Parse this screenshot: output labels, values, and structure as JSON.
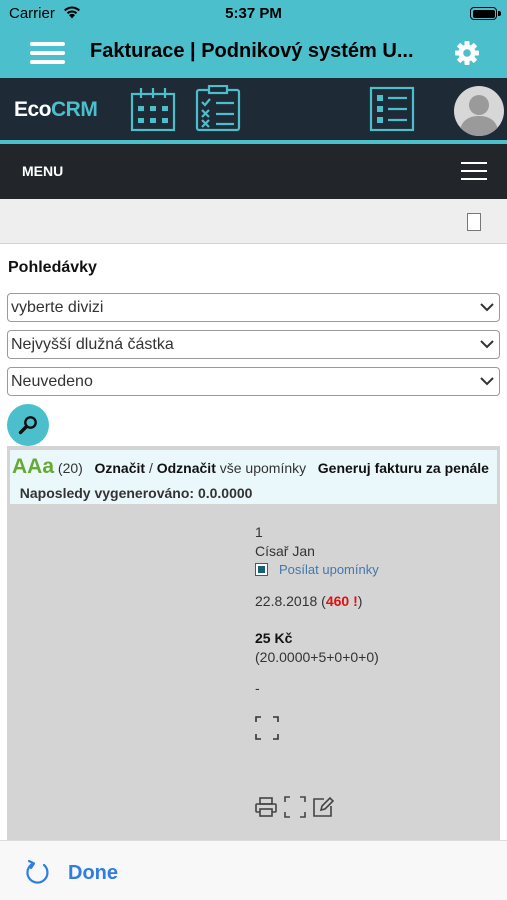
{
  "status_bar": {
    "carrier": "Carrier",
    "time": "5:37 PM"
  },
  "navbar": {
    "title": "Fakturace | Podnikový systém U..."
  },
  "crm": {
    "logo_eco": "Eco",
    "logo_crm": "CRM"
  },
  "menu": {
    "label": "MENU"
  },
  "form": {
    "section_title": "Pohledávky",
    "division_select": "vyberte divizi",
    "sort_select": "Nejvyšší dlužná částka",
    "status_select": "Neuvedeno"
  },
  "panel": {
    "header": {
      "code": "AAa",
      "count": "(20)",
      "mark": "Označit",
      "separator": " / ",
      "unmark": "Odznačit",
      "all_reminders": "vše upomínky",
      "generate": "Generuj fakturu za penále",
      "last_generated_label": "Naposledy vygenerováno:",
      "last_generated_value": "0.0.0000"
    },
    "record": {
      "number": "1",
      "name": "Císař Jan",
      "send_reminders": "Posílat upomínky",
      "date": "22.8.2018",
      "paren_open": " (",
      "days_overdue": "460 !",
      "paren_close": ")",
      "amount": "25 Kč",
      "formula": "(20.0000+5+0+0+0)",
      "dash": "-"
    }
  },
  "bottom": {
    "done_label": "Done"
  },
  "colors": {
    "accent": "#4bbfcc",
    "header_dark": "#1e2a36",
    "menu_dark": "#22262b",
    "code_green": "#66aa33",
    "overdue_red": "#e01010",
    "ios_blue": "#2f7de2"
  },
  "icons": {
    "status": [
      "wifi-icon",
      "battery-icon"
    ],
    "navbar": [
      "hamburger-icon",
      "gear-icon"
    ],
    "crm": [
      "calendar-icon",
      "checklist-icon",
      "list-icon",
      "avatar"
    ],
    "panel": [
      "fullscreen-icon",
      "print-icon",
      "edit-icon"
    ],
    "bottom": [
      "refresh-icon"
    ]
  }
}
